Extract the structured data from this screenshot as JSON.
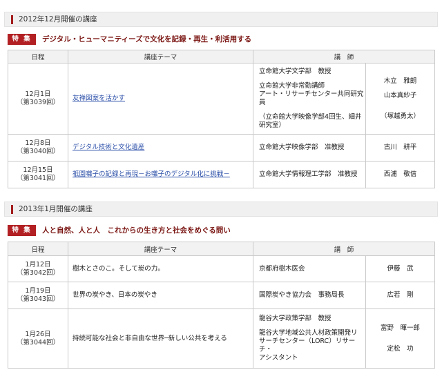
{
  "section1": {
    "header": "2012年12月開催の講座",
    "badge": "特 集",
    "feature_title": "デジタル・ヒューマニティーズで文化を記録・再生・利活用する",
    "col_date": "日程",
    "col_theme": "講座テーマ",
    "col_lecturer": "講　師",
    "rows": [
      {
        "date": "12月1日",
        "session": "（第3039回）",
        "theme": "友禅図案を活かす",
        "affil": [
          "立命館大学文学部　教授",
          "立命館大学非常勤講師",
          "アート・リサーチセンター共同研究員",
          "（立命館大学映像学部4回生、細井",
          "研究室）"
        ],
        "names": [
          "木立　雅朗",
          "山本真紗子",
          "（塚越勇太）"
        ]
      },
      {
        "date": "12月8日",
        "session": "（第3040回）",
        "theme": "デジタル技術と文化遺産",
        "affil": [
          "立命館大学映像学部　准教授"
        ],
        "names": [
          "古川　耕平"
        ]
      },
      {
        "date": "12月15日",
        "session": "（第3041回）",
        "theme": "祇園囃子の記録と再現－お囃子のデジタル化に挑戦－",
        "affil": [
          "立命館大学情報理工学部　准教授"
        ],
        "names": [
          "西浦　敬信"
        ]
      }
    ]
  },
  "section2": {
    "header": "2013年1月開催の講座",
    "badge": "特 集",
    "feature_title": "人と自然、人と人　これからの生き方と社会をめぐる問い",
    "col_date": "日程",
    "col_theme": "講座テーマ",
    "col_lecturer": "講　師",
    "rows": [
      {
        "date": "1月12日",
        "session": "（第3042回）",
        "theme": "樹木とさのこ。そして炭の力。",
        "affil": [
          "京都府樹木医会"
        ],
        "names": [
          "伊藤　武"
        ]
      },
      {
        "date": "1月19日",
        "session": "（第3043回）",
        "theme": "世界の炭やき、日本の炭やき",
        "affil": [
          "国際炭やき協力会　事務局長"
        ],
        "names": [
          "広若　剛"
        ]
      },
      {
        "date": "1月26日",
        "session": "（第3044回）",
        "theme": "持続可能な社会と非自由な世界─新しい公共を考える",
        "affil": [
          "龍谷大学政策学部　教授",
          "龍谷大学地域公共人材政策開発リ",
          "サーチセンター（LORC）リサーチ・",
          "アシスタント"
        ],
        "names": [
          "富野　暉一郎",
          "定松　功"
        ]
      }
    ]
  }
}
